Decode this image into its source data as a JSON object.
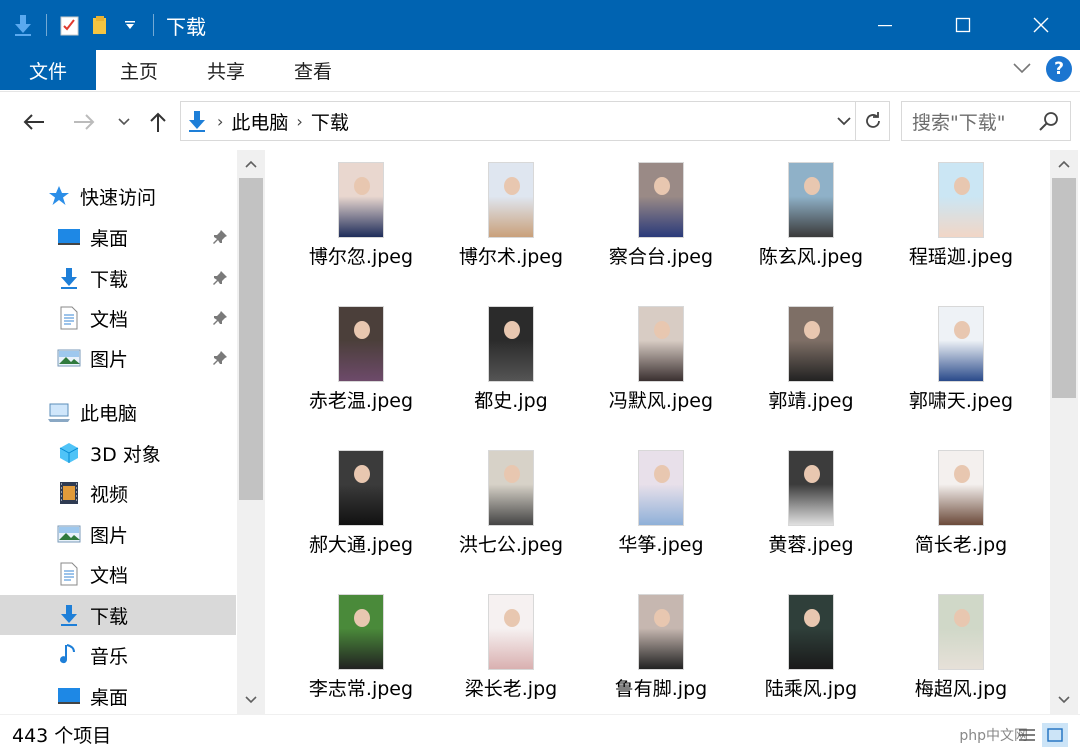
{
  "window": {
    "title": "下载",
    "minimize_label": "—",
    "maximize_label": "□",
    "close_label": "✕"
  },
  "ribbon": {
    "file_tab": "文件",
    "tabs": [
      "主页",
      "共享",
      "查看"
    ],
    "help_label": "?"
  },
  "address": {
    "crumbs": [
      "此电脑",
      "下载"
    ],
    "search_placeholder": "搜索\"下载\""
  },
  "sidebar": {
    "items": [
      {
        "label": "快速访问",
        "icon": "star-icon",
        "pinned": false
      },
      {
        "label": "桌面",
        "icon": "desktop-icon",
        "pinned": true
      },
      {
        "label": "下载",
        "icon": "download-icon",
        "pinned": true
      },
      {
        "label": "文档",
        "icon": "document-icon",
        "pinned": true
      },
      {
        "label": "图片",
        "icon": "pictures-icon",
        "pinned": true
      },
      {
        "label": "此电脑",
        "icon": "computer-icon",
        "pinned": false
      },
      {
        "label": "3D 对象",
        "icon": "3d-objects-icon",
        "pinned": false
      },
      {
        "label": "视频",
        "icon": "video-icon",
        "pinned": false
      },
      {
        "label": "图片",
        "icon": "pictures-icon",
        "pinned": false
      },
      {
        "label": "文档",
        "icon": "document-icon",
        "pinned": false
      },
      {
        "label": "下载",
        "icon": "download-icon",
        "pinned": false,
        "selected": true
      },
      {
        "label": "音乐",
        "icon": "music-icon",
        "pinned": false
      },
      {
        "label": "桌面",
        "icon": "desktop-icon",
        "pinned": false
      }
    ]
  },
  "files": [
    {
      "name": "博尔忽.jpeg"
    },
    {
      "name": "博尔术.jpeg"
    },
    {
      "name": "察合台.jpeg"
    },
    {
      "name": "陈玄风.jpeg"
    },
    {
      "name": "程瑶迦.jpeg"
    },
    {
      "name": "赤老温.jpeg"
    },
    {
      "name": "都史.jpg"
    },
    {
      "name": "冯默风.jpeg"
    },
    {
      "name": "郭靖.jpeg"
    },
    {
      "name": "郭啸天.jpeg"
    },
    {
      "name": "郝大通.jpeg"
    },
    {
      "name": "洪七公.jpeg"
    },
    {
      "name": "华筝.jpeg"
    },
    {
      "name": "黄蓉.jpeg"
    },
    {
      "name": "简长老.jpg"
    },
    {
      "name": "李志常.jpeg"
    },
    {
      "name": "梁长老.jpg"
    },
    {
      "name": "鲁有脚.jpg"
    },
    {
      "name": "陆乘风.jpg"
    },
    {
      "name": "梅超风.jpg"
    }
  ],
  "status": {
    "item_count": "443 个项目",
    "watermark": "php中文网"
  },
  "colors": {
    "accent": "#0063b1",
    "selected_bg": "#d9d9d9"
  }
}
